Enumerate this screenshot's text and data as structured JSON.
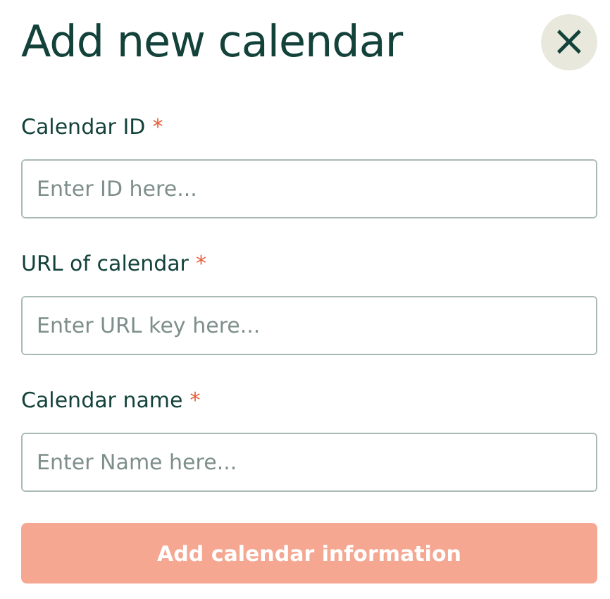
{
  "dialog": {
    "title": "Add new calendar",
    "close_icon": "×"
  },
  "fields": [
    {
      "label": "Calendar ID",
      "required_mark": "*",
      "placeholder": "Enter ID here..."
    },
    {
      "label": "URL of calendar",
      "required_mark": "*",
      "placeholder": "Enter URL key here..."
    },
    {
      "label": "Calendar name",
      "required_mark": "*",
      "placeholder": "Enter Name here..."
    }
  ],
  "submit_button": {
    "label": "Add calendar information",
    "disabled": true
  }
}
